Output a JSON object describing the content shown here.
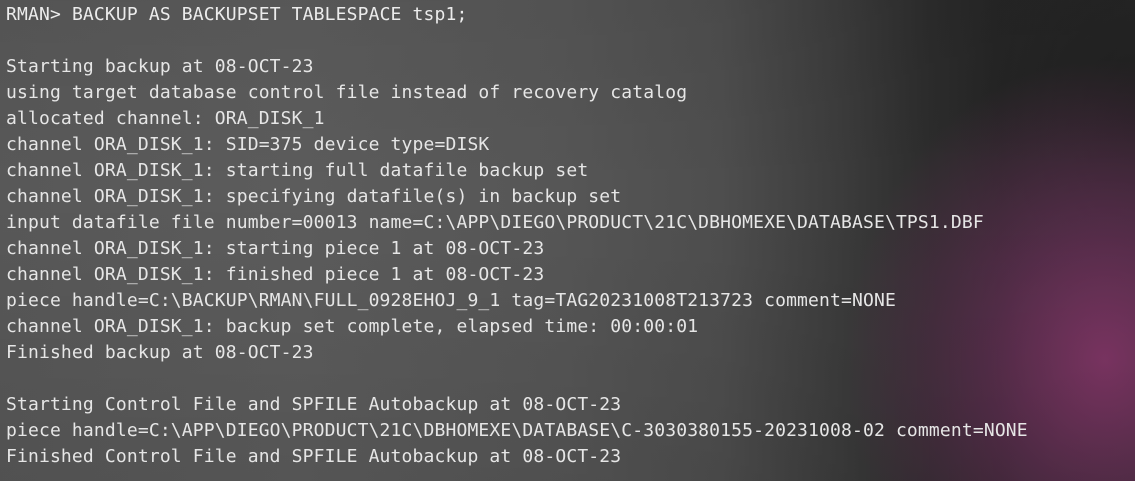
{
  "terminal": {
    "prompt": "RMAN>",
    "command": "BACKUP AS BACKUPSET TABLESPACE tsp1;",
    "lines": [
      "",
      "Starting backup at 08-OCT-23",
      "using target database control file instead of recovery catalog",
      "allocated channel: ORA_DISK_1",
      "channel ORA_DISK_1: SID=375 device type=DISK",
      "channel ORA_DISK_1: starting full datafile backup set",
      "channel ORA_DISK_1: specifying datafile(s) in backup set",
      "input datafile file number=00013 name=C:\\APP\\DIEGO\\PRODUCT\\21C\\DBHOMEXE\\DATABASE\\TPS1.DBF",
      "channel ORA_DISK_1: starting piece 1 at 08-OCT-23",
      "channel ORA_DISK_1: finished piece 1 at 08-OCT-23",
      "piece handle=C:\\BACKUP\\RMAN\\FULL_0928EHOJ_9_1 tag=TAG20231008T213723 comment=NONE",
      "channel ORA_DISK_1: backup set complete, elapsed time: 00:00:01",
      "Finished backup at 08-OCT-23",
      "",
      "Starting Control File and SPFILE Autobackup at 08-OCT-23",
      "piece handle=C:\\APP\\DIEGO\\PRODUCT\\21C\\DBHOMEXE\\DATABASE\\C-3030380155-20231008-02 comment=NONE",
      "Finished Control File and SPFILE Autobackup at 08-OCT-23"
    ]
  }
}
